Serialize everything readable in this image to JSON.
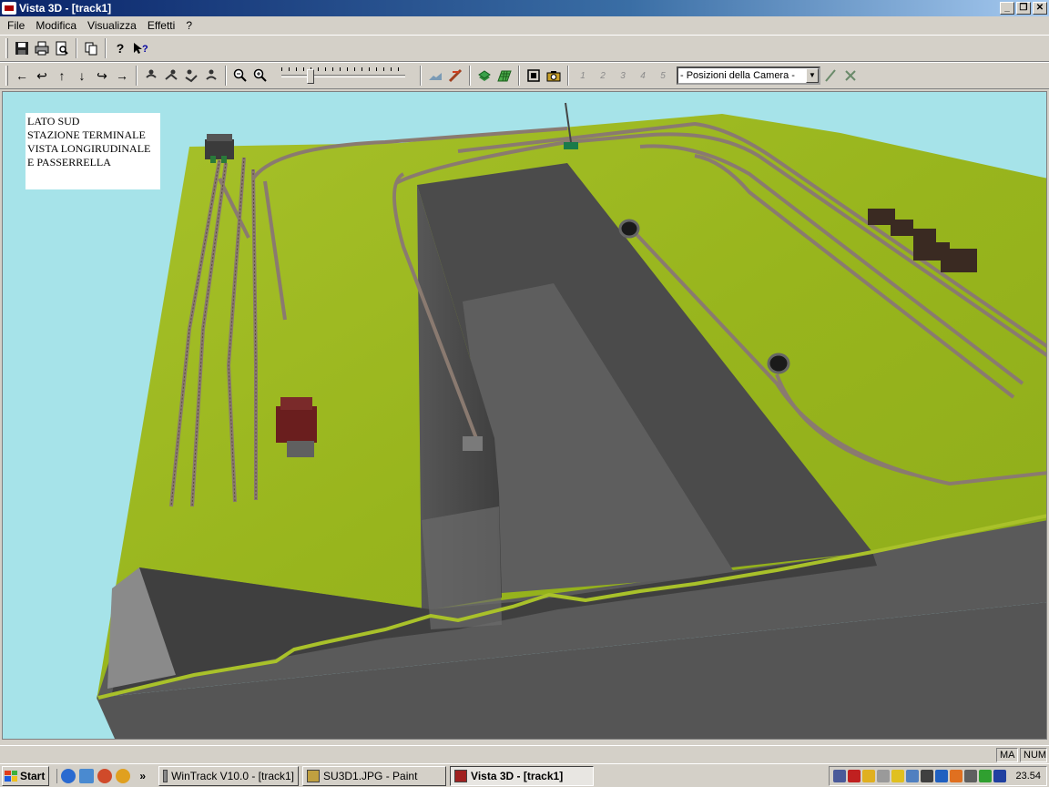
{
  "window": {
    "title": "Vista 3D - [track1]",
    "buttons": [
      "_",
      "❐",
      "✕"
    ]
  },
  "menu": [
    "File",
    "Modifica",
    "Visualizza",
    "Effetti",
    "?"
  ],
  "toolbar1": {
    "tools": [
      "save-icon",
      "print-icon",
      "print-preview-icon",
      "copy-icon",
      "help-icon",
      "context-help-icon"
    ]
  },
  "toolbar2": {
    "nav_tools": [
      "←",
      "↩",
      "↑",
      "↓",
      "↪",
      "→"
    ],
    "camera_tools": [
      "walk-icon",
      "walk-left-icon",
      "walk-right-icon",
      "walk-back-icon"
    ],
    "zoom_tools": [
      "zoom-out-icon",
      "zoom-in-icon"
    ],
    "zoom_level": 0.22,
    "view_tools": [
      "terrain-icon",
      "track-icon",
      "layer-icon",
      "grid-icon",
      "fit-icon",
      "camera-icon"
    ],
    "camera_slots": [
      "1",
      "2",
      "3",
      "4",
      "5"
    ],
    "camera_positions_value": "- Posizioni della Camera -"
  },
  "viewport": {
    "label_lines": [
      "LATO SUD",
      "STAZIONE TERMINALE",
      "VISTA LONGIRUDINALE",
      "E PASSERRELLA"
    ]
  },
  "status": {
    "caps": "MA",
    "num": "NUM"
  },
  "taskbar": {
    "start": "Start",
    "tasks": [
      "WinTrack  V10.0 - [track1]",
      "SU3D1.JPG - Paint",
      "Vista 3D - [track1]"
    ],
    "clock": "23.54"
  },
  "colors": {
    "sky": "#a6e3e9",
    "grass": "#9fba1e",
    "pit": "#4c4c4c",
    "titlebar": "#0a246a"
  }
}
